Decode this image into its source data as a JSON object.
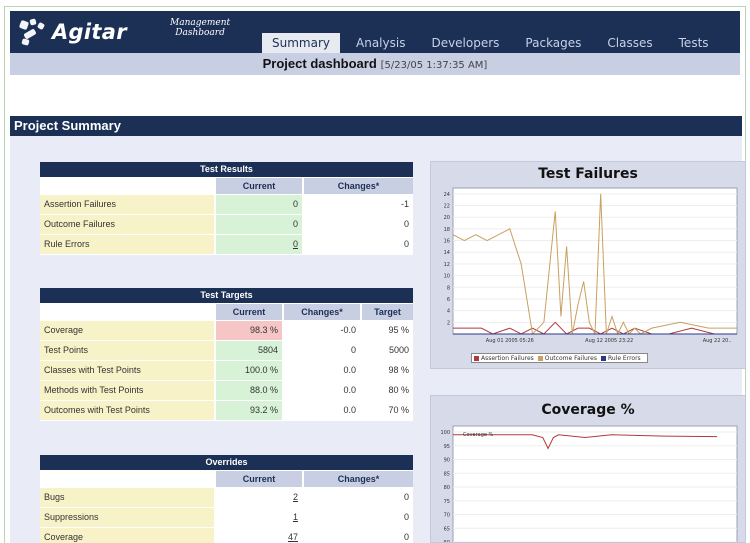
{
  "brand": {
    "name": "Agitar",
    "product_line1": "Management",
    "product_line2": "Dashboard"
  },
  "tabs": [
    {
      "label": "Summary",
      "active": true
    },
    {
      "label": "Analysis",
      "active": false
    },
    {
      "label": "Developers",
      "active": false
    },
    {
      "label": "Packages",
      "active": false
    },
    {
      "label": "Classes",
      "active": false
    },
    {
      "label": "Tests",
      "active": false
    }
  ],
  "subheader": {
    "title": "Project dashboard",
    "timestamp": "[5/23/05 1:37:35 AM]"
  },
  "section_title": "Project Summary",
  "test_results": {
    "caption": "Test Results",
    "headers": [
      "Current",
      "Changes*"
    ],
    "rows": [
      {
        "label": "Assertion Failures",
        "current": "0",
        "change": "-1"
      },
      {
        "label": "Outcome Failures",
        "current": "0",
        "change": "0"
      },
      {
        "label": "Rule Errors",
        "current": "0",
        "change": "0"
      }
    ]
  },
  "test_targets": {
    "caption": "Test Targets",
    "headers": [
      "Current",
      "Changes*",
      "Target"
    ],
    "rows": [
      {
        "label": "Coverage",
        "current": "98.3 %",
        "change": "-0.0",
        "target": "95 %",
        "status": "bad"
      },
      {
        "label": "Test Points",
        "current": "5804",
        "change": "0",
        "target": "5000",
        "status": "good"
      },
      {
        "label": "Classes with Test Points",
        "current": "100.0 %",
        "change": "0.0",
        "target": "98 %",
        "status": "good"
      },
      {
        "label": "Methods with Test Points",
        "current": "88.0 %",
        "change": "0.0",
        "target": "80 %",
        "status": "good"
      },
      {
        "label": "Outcomes with Test Points",
        "current": "93.2 %",
        "change": "0.0",
        "target": "70 %",
        "status": "good"
      }
    ]
  },
  "overrides": {
    "caption": "Overrides",
    "headers": [
      "Current",
      "Changes*"
    ],
    "rows": [
      {
        "label": "Bugs",
        "current": "2",
        "change": "0"
      },
      {
        "label": "Suppressions",
        "current": "1",
        "change": "0"
      },
      {
        "label": "Coverage",
        "current": "47",
        "change": "0"
      }
    ]
  },
  "colors": {
    "navy": "#1c2f55",
    "assertion": "#b03a3a",
    "outcome": "#c8a060",
    "rule": "#2a3a8a"
  },
  "chart_data": [
    {
      "type": "line",
      "title": "Test Failures",
      "y_ticks": [
        "2",
        "4",
        "6",
        "8",
        "10",
        "12",
        "14",
        "16",
        "18",
        "20",
        "22",
        "24"
      ],
      "ylim": [
        0,
        25
      ],
      "x_tick_labels": [
        "Aug 01 2005 05:26",
        "Aug 12 2005 23:22",
        "Aug 22 20.."
      ],
      "legend": [
        "Assertion Failures",
        "Outcome Failures",
        "Rule Errors"
      ],
      "legend_position": "bottom",
      "series": [
        {
          "name": "Assertion Failures",
          "color": "#b03a3a",
          "x": [
            0,
            6,
            10,
            14,
            20,
            24,
            28,
            32,
            36,
            40,
            44,
            48,
            52,
            56,
            60,
            64,
            70,
            76,
            84,
            92,
            100
          ],
          "values": [
            1,
            1,
            1,
            0,
            1,
            0,
            1,
            0,
            2,
            0,
            1,
            1,
            0,
            1,
            0,
            1,
            0,
            0,
            1,
            0,
            0
          ]
        },
        {
          "name": "Outcome Failures",
          "color": "#c8a060",
          "x": [
            0,
            4,
            8,
            12,
            16,
            20,
            24,
            28,
            32,
            36,
            38,
            40,
            42,
            44,
            46,
            48,
            50,
            52,
            54,
            56,
            58,
            60,
            62,
            64,
            66,
            70,
            80,
            90,
            100
          ],
          "values": [
            17,
            16,
            17,
            16,
            17,
            18,
            12,
            0,
            2,
            21,
            3,
            15,
            0,
            5,
            9,
            2,
            0,
            24,
            0,
            3,
            0,
            2,
            0,
            1,
            0,
            1,
            2,
            1,
            1
          ]
        },
        {
          "name": "Rule Errors",
          "color": "#2a3a8a",
          "x": [
            0,
            100
          ],
          "values": [
            0,
            0
          ]
        }
      ]
    },
    {
      "type": "line",
      "title": "Coverage %",
      "y_ticks": [
        "100",
        "95",
        "90",
        "85",
        "80",
        "75",
        "70",
        "65",
        "60"
      ],
      "legend": [
        "Coverage %"
      ],
      "series": [
        {
          "name": "Coverage %",
          "color": "#b03a3a",
          "x": [
            0,
            20,
            30,
            34,
            36,
            38,
            40,
            50,
            60,
            80,
            100
          ],
          "values": [
            99,
            99,
            99,
            98,
            94,
            98,
            99,
            98,
            99,
            98.5,
            98.3
          ]
        }
      ]
    }
  ]
}
